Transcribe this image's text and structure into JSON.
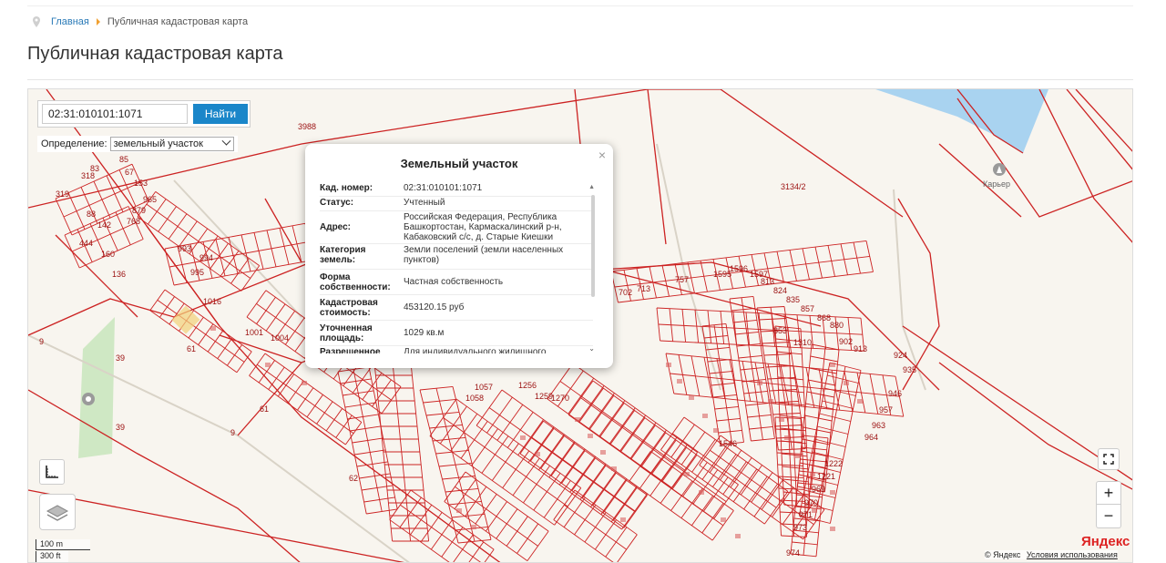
{
  "breadcrumb": {
    "home": "Главная",
    "current": "Публичная кадастровая карта"
  },
  "page_title": "Публичная кадастровая карта",
  "search": {
    "value": "02:31:010101:1071",
    "button": "Найти"
  },
  "definition": {
    "label": "Определение:",
    "selected": "земельный участок"
  },
  "popup": {
    "close": "×",
    "title": "Земельный участок",
    "rows": [
      {
        "key": "Кад. номер:",
        "value": "02:31:010101:1071"
      },
      {
        "key": "Статус:",
        "value": "Учтенный"
      },
      {
        "key": "Адрес:",
        "value": "Российская Федерация, Республика Башкортостан, Кармаскалинский р-н, Кабаковский с/с, д. Старые Киешки"
      },
      {
        "key": "Категория земель:",
        "value": "Земли поселений (земли населенных пунктов)"
      },
      {
        "key": "Форма собственности:",
        "value": "Частная собственность"
      },
      {
        "key": "Кадастровая стоимость:",
        "value": "453120.15 руб"
      },
      {
        "key": "Уточненная площадь:",
        "value": "1029 кв.м"
      },
      {
        "key": "Разрешенное",
        "value": "Для индивидуального жилищного"
      }
    ]
  },
  "map_labels": {
    "l3988": "3988",
    "l3134": "3134/2",
    "quarry": "Карьер",
    "l9a": "9",
    "l39a": "39",
    "l61a": "61",
    "l39b": "39",
    "l61b": "61",
    "l9b": "9",
    "l62": "62",
    "l924": "924",
    "l935": "935",
    "l946": "946",
    "l957": "957",
    "l963": "963",
    "l964": "964",
    "l1222": "1222",
    "l1221": "1221",
    "l969": "969",
    "l970": "970",
    "l971": "971",
    "l973": "973",
    "l974": "974",
    "l1546": "1546",
    "l853": "853",
    "l1310": "1310",
    "l1058": "1058",
    "l1057": "1057",
    "l1256": "1256",
    "l1259": "1259",
    "l1270": "1270",
    "l1004": "1004",
    "l1001": "1001",
    "l1016": "1016",
    "l993": "993",
    "l994": "994",
    "l995": "995",
    "l965": "965",
    "l879": "879",
    "l768": "768",
    "l153": "153",
    "l136": "136",
    "l160": "160",
    "l444": "444",
    "l318": "318",
    "l319": "319",
    "l83": "83",
    "l88": "88",
    "l142": "142",
    "l67": "67",
    "l85": "85",
    "l702": "702",
    "l713": "713",
    "l757": "757",
    "l1595": "1595",
    "l1596": "1596",
    "l1597": "1597",
    "l813": "813",
    "l824": "824",
    "l835": "835",
    "l857": "857",
    "l868": "868",
    "l880": "880",
    "l902": "902",
    "l913": "913"
  },
  "scale": {
    "metric": "100 m",
    "imperial": "300 ft"
  },
  "zoom": {
    "in": "+",
    "out": "−"
  },
  "attribution": {
    "logo": "Яндекс",
    "copyright": "© Яндекс",
    "terms": "Условия использования"
  },
  "colors": {
    "parcel_line": "#cc2222",
    "water": "#a9d3f0",
    "forest": "#cfe8c4",
    "link": "#2a7ab7",
    "button": "#1a86c9"
  }
}
